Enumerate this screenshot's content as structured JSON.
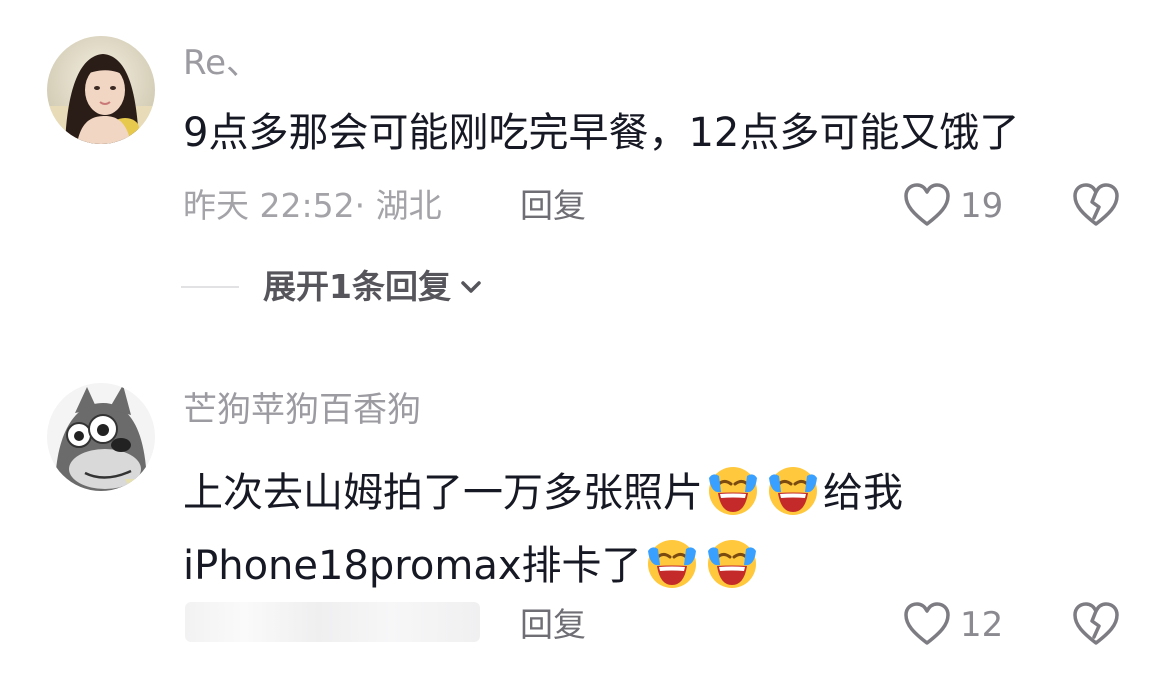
{
  "comments": [
    {
      "username": "Re、",
      "text": "9点多那会可能刚吃完早餐，12点多可能又饿了",
      "meta": "昨天 22:52· 湖北",
      "reply_label": "回复",
      "likes": "19",
      "expand_replies": "展开1条回复"
    },
    {
      "username": "芒狗苹狗百香狗",
      "text_line1": "上次去山姆拍了一万多张照片",
      "text_line1_end": "给我",
      "text_line2": "iPhone18promax排卡了",
      "reply_label": "回复",
      "likes": "12"
    }
  ],
  "icons": {
    "like": "heart-outline-icon",
    "dislike": "broken-heart-icon",
    "expand": "chevron-down-icon",
    "emoji": "laughing-crying-emoji"
  },
  "colors": {
    "text": "#161823",
    "muted": "#a3a3a8",
    "username": "#9b9ba1"
  }
}
